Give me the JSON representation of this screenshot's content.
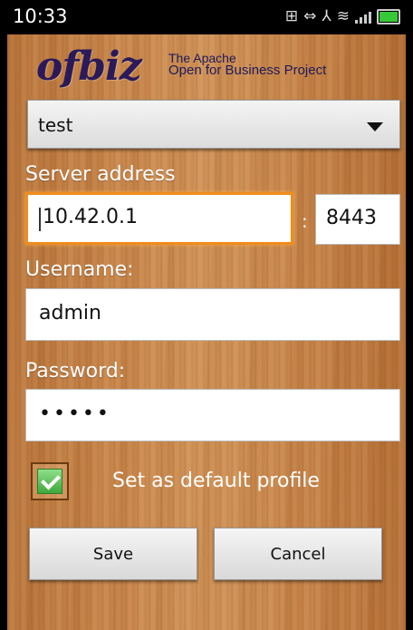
{
  "status_bar": {
    "time": "10:33",
    "icons": [
      "grid-icon",
      "usb-icon",
      "debug-icon",
      "wifi-icon",
      "signal-icon",
      "battery-icon"
    ]
  },
  "logo": {
    "brand": "ofbiz",
    "tagline_line1": "The Apache",
    "tagline_line2": "Open for Business Project"
  },
  "profile_select": {
    "selected": "test"
  },
  "server": {
    "label": "Server address",
    "address": "10.42.0.1",
    "separator": ":",
    "port": "8443"
  },
  "username": {
    "label": "Username:",
    "value": "admin"
  },
  "password": {
    "label": "Password:",
    "value": "•••••"
  },
  "default_profile": {
    "label": "Set as default profile",
    "checked": true
  },
  "buttons": {
    "save": "Save",
    "cancel": "Cancel"
  },
  "colors": {
    "focus": "#f08c1c",
    "check": "#3ea83a",
    "wood": "#c8864b"
  }
}
